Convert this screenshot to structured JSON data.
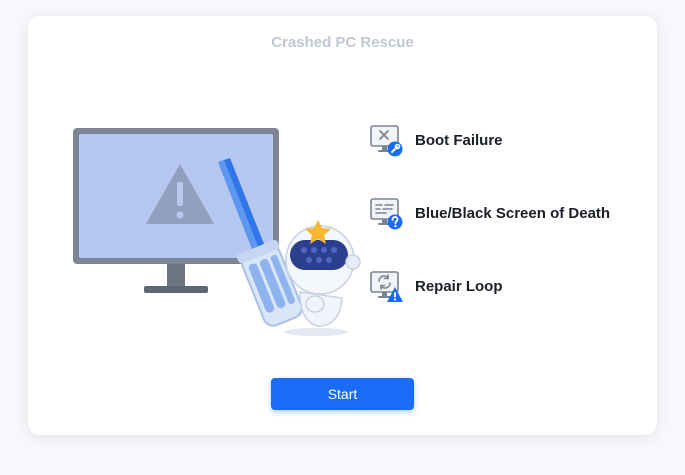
{
  "title": "Crashed PC Rescue",
  "issues": [
    {
      "label": "Boot Failure",
      "icon": "monitor-x-wrench-icon"
    },
    {
      "label": "Blue/Black Screen of Death",
      "icon": "monitor-question-icon"
    },
    {
      "label": "Repair Loop",
      "icon": "monitor-loop-warning-icon"
    }
  ],
  "start_button": {
    "label": "Start"
  },
  "colors": {
    "accent": "#1a6bf5",
    "screen": "#b6c7f0",
    "monitor_frame": "#7d8594",
    "title_text": "#c2c8d2",
    "warning": "#1a6bf5"
  }
}
